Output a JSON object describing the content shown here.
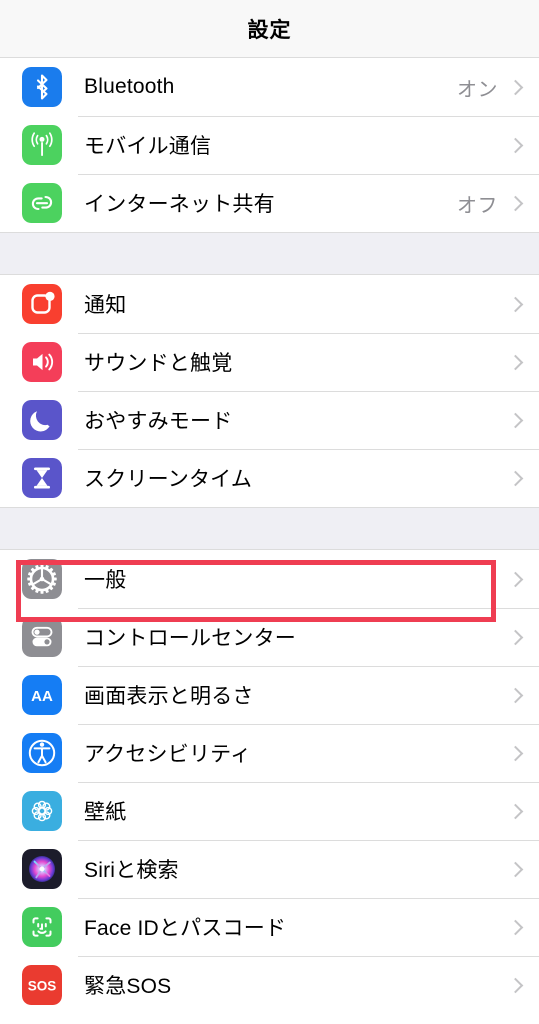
{
  "header": {
    "title": "設定"
  },
  "highlight": {
    "color": "#ef3d52",
    "target_row": "一般"
  },
  "sections": [
    {
      "id": "connectivity",
      "rows": [
        {
          "label": "Bluetooth",
          "value": "オン",
          "icon": "bluetooth-icon",
          "icon_color": "#1a7ced",
          "chevron": "chevron-right-icon"
        },
        {
          "label": "モバイル通信",
          "value": "",
          "icon": "cellular-antenna-icon",
          "icon_color": "#4cd25f",
          "chevron": "chevron-right-icon"
        },
        {
          "label": "インターネット共有",
          "value": "オフ",
          "icon": "personal-hotspot-icon",
          "icon_color": "#4cd25f",
          "chevron": "chevron-right-icon"
        }
      ]
    },
    {
      "id": "alerts",
      "rows": [
        {
          "label": "通知",
          "value": "",
          "icon": "notifications-icon",
          "icon_color": "#f93f2f",
          "chevron": "chevron-right-icon"
        },
        {
          "label": "サウンドと触覚",
          "value": "",
          "icon": "sounds-haptics-icon",
          "icon_color": "#f43e59",
          "chevron": "chevron-right-icon"
        },
        {
          "label": "おやすみモード",
          "value": "",
          "icon": "do-not-disturb-moon-icon",
          "icon_color": "#5a55ca",
          "chevron": "chevron-right-icon"
        },
        {
          "label": "スクリーンタイム",
          "value": "",
          "icon": "screen-time-hourglass-icon",
          "icon_color": "#5a55ca",
          "chevron": "chevron-right-icon"
        }
      ]
    },
    {
      "id": "system",
      "rows": [
        {
          "label": "一般",
          "value": "",
          "icon": "settings-gear-icon",
          "icon_color": "#8e8e93",
          "chevron": "chevron-right-icon"
        },
        {
          "label": "コントロールセンター",
          "value": "",
          "icon": "control-center-toggles-icon",
          "icon_color": "#8e8e93",
          "chevron": "chevron-right-icon"
        },
        {
          "label": "画面表示と明るさ",
          "value": "",
          "icon": "display-brightness-aa-icon",
          "icon_color": "#157df4",
          "chevron": "chevron-right-icon"
        },
        {
          "label": "アクセシビリティ",
          "value": "",
          "icon": "accessibility-icon",
          "icon_color": "#157df4",
          "chevron": "chevron-right-icon"
        },
        {
          "label": "壁紙",
          "value": "",
          "icon": "wallpaper-flower-icon",
          "icon_color": "#3aaee0",
          "chevron": "chevron-right-icon"
        },
        {
          "label": "Siriと検索",
          "value": "",
          "icon": "siri-orb-icon",
          "icon_color": "#1c1c2b",
          "chevron": "chevron-right-icon"
        },
        {
          "label": "Face IDとパスコード",
          "value": "",
          "icon": "face-id-icon",
          "icon_color": "#43cc5e",
          "chevron": "chevron-right-icon"
        },
        {
          "label": "緊急SOS",
          "value": "",
          "icon": "emergency-sos-icon",
          "icon_color": "#ea3b30",
          "chevron": "chevron-right-icon"
        }
      ]
    }
  ],
  "icon_text": {
    "display_brightness": "AA",
    "emergency_sos": "SOS"
  }
}
